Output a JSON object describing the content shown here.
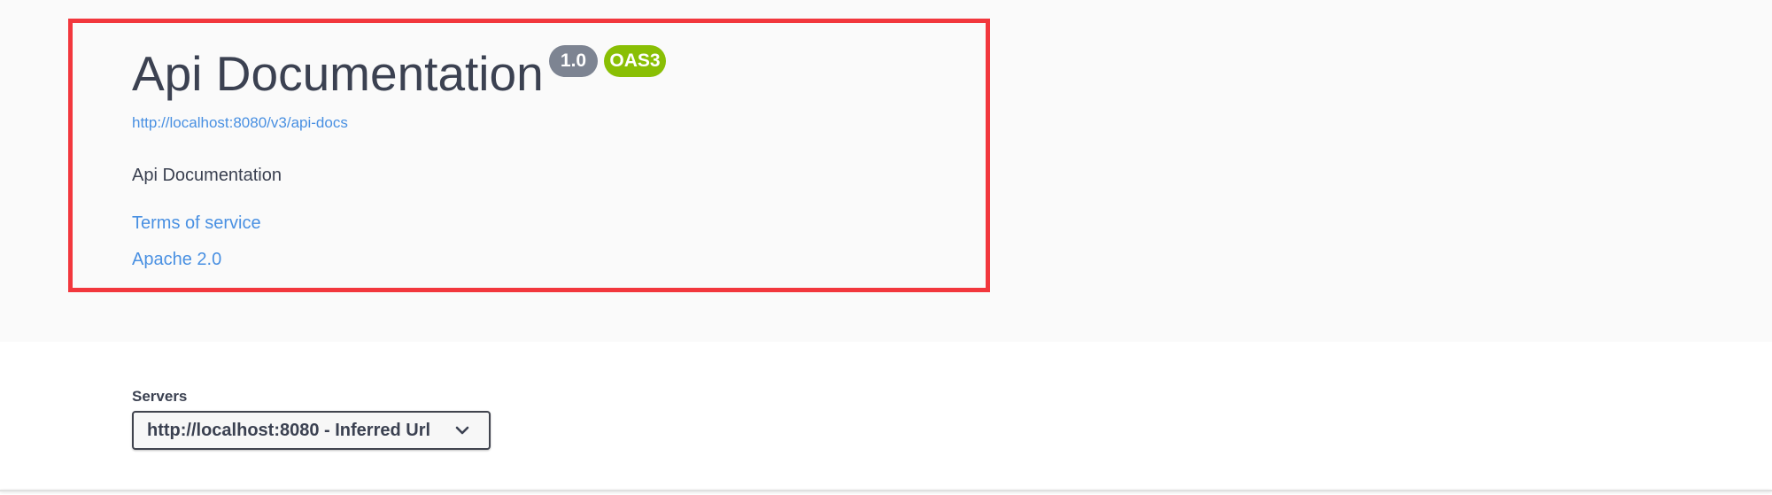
{
  "info": {
    "title": "Api Documentation",
    "version_badge": "1.0",
    "oas_badge": "OAS3",
    "api_url": "http://localhost:8080/v3/api-docs",
    "description": "Api Documentation",
    "terms_link": "Terms of service",
    "license_link": "Apache 2.0"
  },
  "servers": {
    "label": "Servers",
    "selected": "http://localhost:8080 - Inferred Url"
  },
  "colors": {
    "highlight": "#f2373d",
    "version_badge": "#7d8492",
    "oas_badge": "#89bf04",
    "link": "#4990e2",
    "text": "#3b4151"
  },
  "icons": {
    "select_indicator": "chevron-down-icon"
  }
}
